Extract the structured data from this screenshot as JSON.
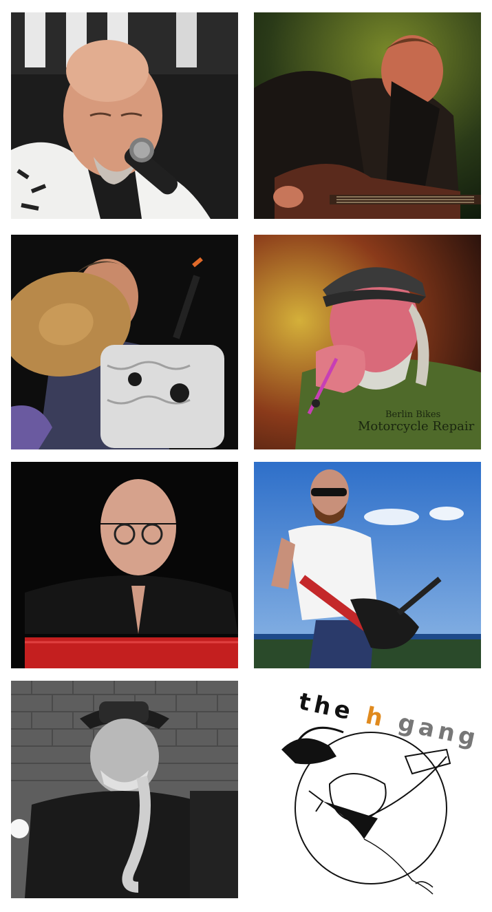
{
  "photos": [
    {
      "subject": "vocalist-with-microphone"
    },
    {
      "subject": "guitarist-leather-jacket"
    },
    {
      "subject": "drummer-at-kit"
    },
    {
      "subject": "harmonica-singer-in-cap"
    },
    {
      "subject": "keyboard-player"
    },
    {
      "subject": "guitarist-outdoors"
    },
    {
      "subject": "saxophonist-in-hat"
    }
  ],
  "shirt_print": {
    "line1": "Berlin Bikes",
    "line2": "Motorcycle Repair"
  },
  "logo": {
    "word1": "the",
    "letter": "h",
    "word2": "gang",
    "letter_color": "#e08a1e",
    "text_color": "#111111"
  }
}
